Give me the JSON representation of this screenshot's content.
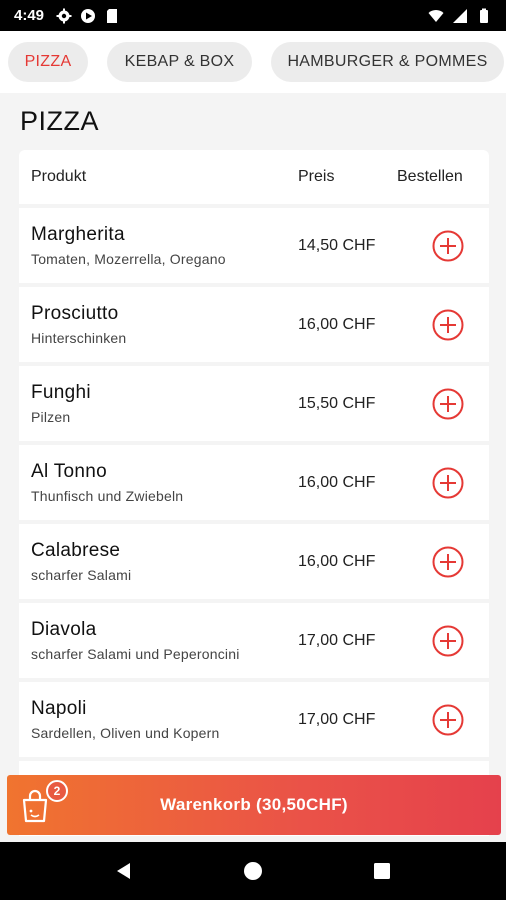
{
  "status_bar": {
    "time": "4:49",
    "left_icons": [
      "gear-icon",
      "play-icon",
      "sd-card-icon"
    ],
    "right_icons": [
      "wifi-icon",
      "signal-icon",
      "battery-icon"
    ]
  },
  "tabs": [
    {
      "label": "PIZZA",
      "active": true
    },
    {
      "label": "KEBAP & BOX",
      "active": false
    },
    {
      "label": "HAMBURGER & POMMES",
      "active": false
    }
  ],
  "section_title": "PIZZA",
  "table": {
    "headers": {
      "product": "Produkt",
      "price": "Preis",
      "order": "Bestellen"
    },
    "rows": [
      {
        "name": "Margherita",
        "desc": "Tomaten, Mozerrella, Oregano",
        "price": "14,50 CHF"
      },
      {
        "name": "Prosciutto",
        "desc": "Hinterschinken",
        "price": "16,00 CHF"
      },
      {
        "name": "Funghi",
        "desc": "Pilzen",
        "price": "15,50 CHF"
      },
      {
        "name": "Al Tonno",
        "desc": "Thunfisch und Zwiebeln",
        "price": "16,00 CHF"
      },
      {
        "name": "Calabrese",
        "desc": "scharfer Salami",
        "price": "16,00 CHF"
      },
      {
        "name": "Diavola",
        "desc": "scharfer Salami und Peperoncini",
        "price": "17,00 CHF"
      },
      {
        "name": "Napoli",
        "desc": "Sardellen, Oliven und Kopern",
        "price": "17,00 CHF"
      }
    ]
  },
  "cart": {
    "label": "Warenkorb (30,50CHF)",
    "badge_count": "2"
  },
  "colors": {
    "accent": "#e53935",
    "cart_gradient_start": "#f0742f",
    "cart_gradient_end": "#e5414c"
  }
}
